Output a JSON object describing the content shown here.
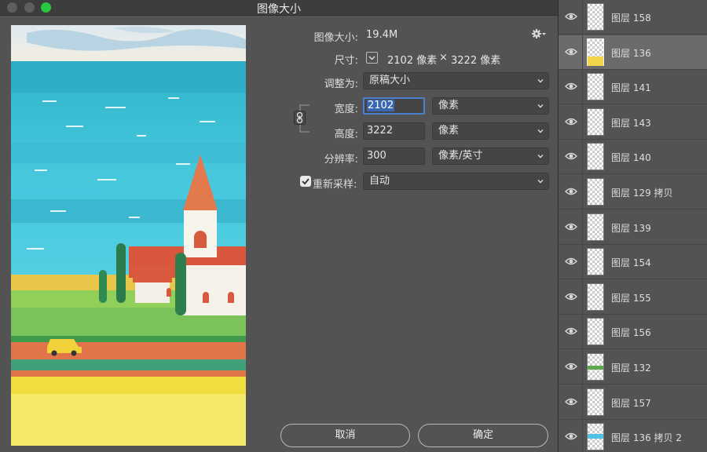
{
  "dialog": {
    "title": "图像大小",
    "image_size_label": "图像大小:",
    "image_size_value": "19.4M",
    "dimensions_label": "尺寸:",
    "dimensions_width": "2102 像素",
    "dimensions_times": "×",
    "dimensions_height": "3222 像素",
    "fit_to_label": "调整为:",
    "fit_to_value": "原稿大小",
    "width_label": "宽度:",
    "width_value": "2102",
    "width_unit": "像素",
    "height_label": "高度:",
    "height_value": "3222",
    "height_unit": "像素",
    "resolution_label": "分辨率:",
    "resolution_value": "300",
    "resolution_unit": "像素/英寸",
    "resample_label": "重新采样:",
    "resample_checked": true,
    "resample_value": "自动",
    "cancel_label": "取消",
    "ok_label": "确定"
  },
  "layers": [
    {
      "name": "图层 158",
      "visible": true,
      "active": false,
      "thumb_mark": "none"
    },
    {
      "name": "图层 136",
      "visible": true,
      "active": true,
      "thumb_mark": "yellow"
    },
    {
      "name": "图层 141",
      "visible": true,
      "active": false,
      "thumb_mark": "none"
    },
    {
      "name": "图层 143",
      "visible": true,
      "active": false,
      "thumb_mark": "none"
    },
    {
      "name": "图层 140",
      "visible": true,
      "active": false,
      "thumb_mark": "none"
    },
    {
      "name": "图层 129 拷贝",
      "visible": true,
      "active": false,
      "thumb_mark": "none"
    },
    {
      "name": "图层 139",
      "visible": true,
      "active": false,
      "thumb_mark": "none"
    },
    {
      "name": "图层 154",
      "visible": true,
      "active": false,
      "thumb_mark": "none"
    },
    {
      "name": "图层 155",
      "visible": true,
      "active": false,
      "thumb_mark": "none"
    },
    {
      "name": "图层 156",
      "visible": true,
      "active": false,
      "thumb_mark": "none"
    },
    {
      "name": "图层 132",
      "visible": true,
      "active": false,
      "thumb_mark": "green"
    },
    {
      "name": "图层 157",
      "visible": true,
      "active": false,
      "thumb_mark": "none"
    },
    {
      "name": "图层 136 拷贝 2",
      "visible": true,
      "active": false,
      "thumb_mark": "blue"
    }
  ],
  "icons": {
    "gear": "gear-icon",
    "link": "link-icon",
    "eye": "eye-icon",
    "chevron": "chevron-down-icon"
  },
  "colors": {
    "panel": "#535353",
    "accent": "#3967b1",
    "titlebar_green": "#29c840"
  }
}
